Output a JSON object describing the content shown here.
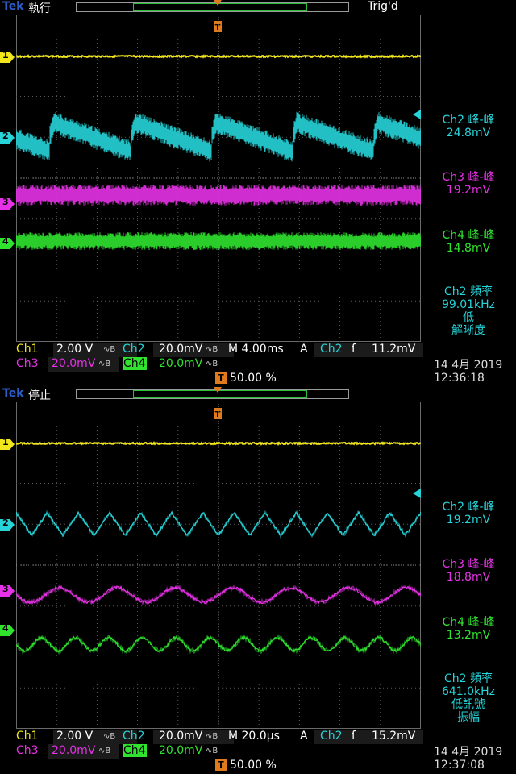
{
  "colors": {
    "ch1": "#f2e61c",
    "ch2": "#26d4d9",
    "ch3": "#e632e6",
    "ch4": "#2fe32f",
    "trigger": "#e07a1a",
    "logo": "#2c5cc5"
  },
  "screens": [
    {
      "logo": "Tek",
      "run_state": "執行",
      "trig_state": "Trig'd",
      "channel_markers": [
        "1",
        "2",
        "3",
        "4"
      ],
      "measurements": [
        {
          "title": "Ch2 峰-峰",
          "value": "24.8mV"
        },
        {
          "title": "Ch3 峰-峰",
          "value": "19.2mV"
        },
        {
          "title": "Ch4 峰-峰",
          "value": "14.8mV"
        }
      ],
      "freq": {
        "title": "Ch2 頻率",
        "value": "99.01kHz",
        "note1": "低",
        "note2": "解晰度"
      },
      "status": {
        "ch1_label": "Ch1",
        "ch1_scale": "2.00 V",
        "ch2_label": "Ch2",
        "ch2_scale": "20.0mV",
        "timebase": "M 4.00ms",
        "trig_mode": "A",
        "trig_src": "Ch2",
        "trig_level": "11.2mV",
        "ch3_label": "Ch3",
        "ch3_scale": "20.0mV",
        "ch4_label": "Ch4",
        "ch4_scale": "20.0mV",
        "hpos": "50.00 %"
      },
      "date": "14 4月  2019",
      "time": "12:36:18",
      "waveforms": {
        "ch2_peaks": 5,
        "ch3_noise": true,
        "ch4_noise": true
      }
    },
    {
      "logo": "Tek",
      "run_state": "停止",
      "trig_state": "",
      "channel_markers": [
        "1",
        "2",
        "3",
        "4"
      ],
      "measurements": [
        {
          "title": "Ch2 峰-峰",
          "value": "19.2mV"
        },
        {
          "title": "Ch3 峰-峰",
          "value": "18.8mV"
        },
        {
          "title": "Ch4 峰-峰",
          "value": "13.2mV"
        }
      ],
      "freq": {
        "title": "Ch2 頻率",
        "value": "641.0kHz",
        "note1": "低訊號",
        "note2": "振幅"
      },
      "status": {
        "ch1_label": "Ch1",
        "ch1_scale": "2.00 V",
        "ch2_label": "Ch2",
        "ch2_scale": "20.0mV",
        "timebase": "M 20.0µs",
        "trig_mode": "A",
        "trig_src": "Ch2",
        "trig_level": "15.2mV",
        "ch3_label": "Ch3",
        "ch3_scale": "20.0mV",
        "ch4_label": "Ch4",
        "ch4_scale": "20.0mV",
        "hpos": "50.00 %"
      },
      "date": "14 4月  2019",
      "time": "12:37:08",
      "waveforms": {
        "ch2_cycles": 13,
        "ch3_cycles": 7,
        "ch4_cycles": 12
      }
    }
  ]
}
